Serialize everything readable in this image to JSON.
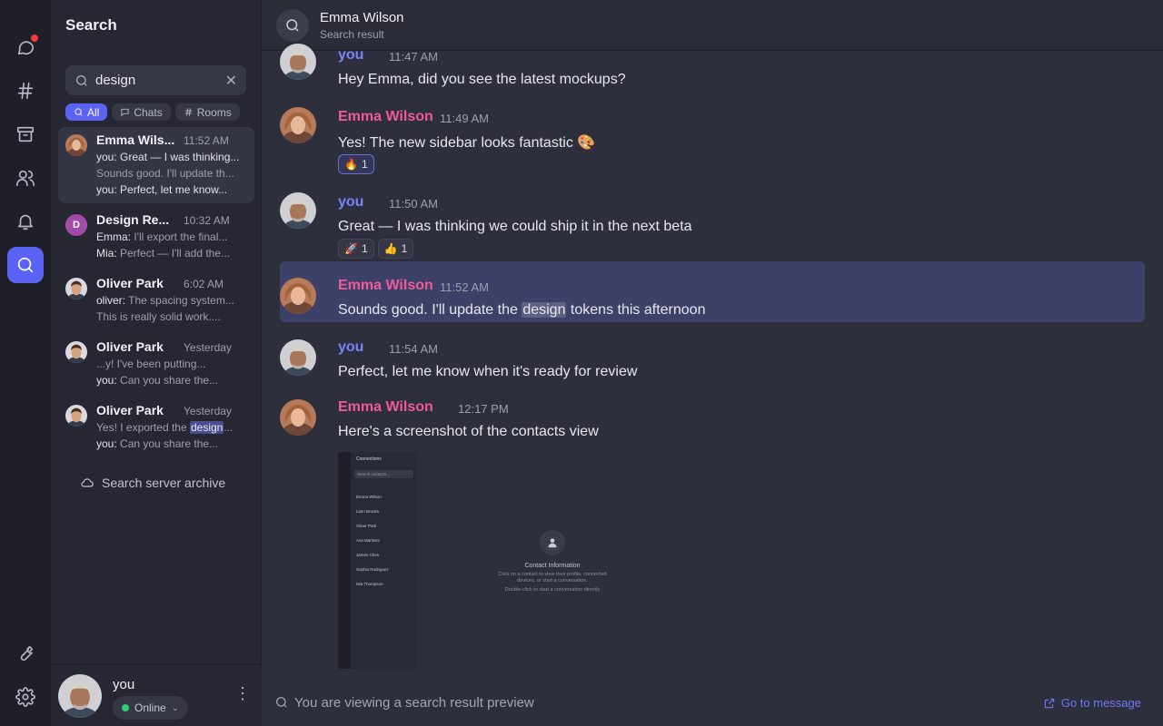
{
  "sidebar": {
    "title": "Search",
    "search": {
      "value": "design",
      "placeholder": ""
    },
    "filters": [
      {
        "label": "All",
        "icon": "search-icon"
      },
      {
        "label": "Chats",
        "icon": "chat-icon"
      },
      {
        "label": "Rooms",
        "icon": "hash-icon"
      }
    ],
    "results": [
      {
        "name": "Emma Wils...",
        "time": "11:52 AM",
        "line1_sender": "you:",
        "line1": " Great — I was thinking...",
        "line2": "Sounds good. I'll update th...",
        "line3_sender": "you:",
        "line3": " Perfect, let me know..."
      },
      {
        "name": "Design Re...",
        "initial": "D",
        "time": "10:32 AM",
        "line1_sender": "Emma:",
        "line1": " I'll export the final...",
        "line2_sender": "Mia:",
        "line2": " Perfect — I'll add the..."
      },
      {
        "name": "Oliver Park",
        "time": "6:02 AM",
        "line1_sender": "oliver:",
        "line1": " The spacing system...",
        "line2": "This is really solid work...."
      },
      {
        "name": "Oliver Park",
        "time": "Yesterday",
        "line1": "...y! I've been putting...",
        "line2_sender": "you:",
        "line2": " Can you share the..."
      },
      {
        "name": "Oliver Park",
        "time": "Yesterday",
        "line1_pre": "Yes! I exported the ",
        "line1_hl": "design",
        "line1_post": "...",
        "line2_sender": "you:",
        "line2": " Can you share the..."
      }
    ],
    "archive_label": "Search server archive"
  },
  "me": {
    "name": "you",
    "status": "Online"
  },
  "main": {
    "header": {
      "title": "Emma Wilson",
      "subtitle": "Search result"
    },
    "messages": [
      {
        "sender": "you",
        "time": "11:47 AM",
        "text": "Hey Emma, did you see the latest mockups?"
      },
      {
        "sender": "Emma Wilson",
        "time": "11:49 AM",
        "text": "Yes! The new sidebar looks fantastic 🎨",
        "reactions": [
          {
            "emoji": "🔥",
            "count": "1"
          }
        ]
      },
      {
        "sender": "you",
        "time": "11:50 AM",
        "text": "Great — I was thinking we could ship it in the next beta",
        "reactions": [
          {
            "emoji": "🚀",
            "count": "1"
          },
          {
            "emoji": "👍",
            "count": "1"
          }
        ]
      },
      {
        "sender": "Emma Wilson",
        "time": "11:52 AM",
        "text_pre": "Sounds good. I'll update the ",
        "text_hl": "design",
        "text_post": " tokens this afternoon"
      },
      {
        "sender": "you",
        "time": "11:54 AM",
        "text": "Perfect, let me know when it's ready for review"
      },
      {
        "sender": "Emma Wilson",
        "time": "12:17 PM",
        "text": "Here's a screenshot of the contacts view"
      }
    ],
    "attachment": {
      "title": "Connections",
      "search_placeholder": "Search contacts...",
      "contacts": [
        "Emma Wilson",
        "Liam Brooks",
        "Oliver Park",
        "Ava Martinez",
        "James Chen",
        "Sophia Rodriguez",
        "Mia Thompson"
      ],
      "panel_title": "Contact Information",
      "panel_text": "Click on a contact to view their profile, connected devices, or start a conversation.",
      "panel_hint": "Double-click to start a conversation directly"
    },
    "footer": {
      "text": "You are viewing a search result preview",
      "goto_label": "Go to message"
    }
  },
  "colors": {
    "accent": "#5b63f5",
    "you": "#7b82f7",
    "emma": "#f05a97",
    "online": "#2fcf6e",
    "notification": "#ef3b47"
  }
}
